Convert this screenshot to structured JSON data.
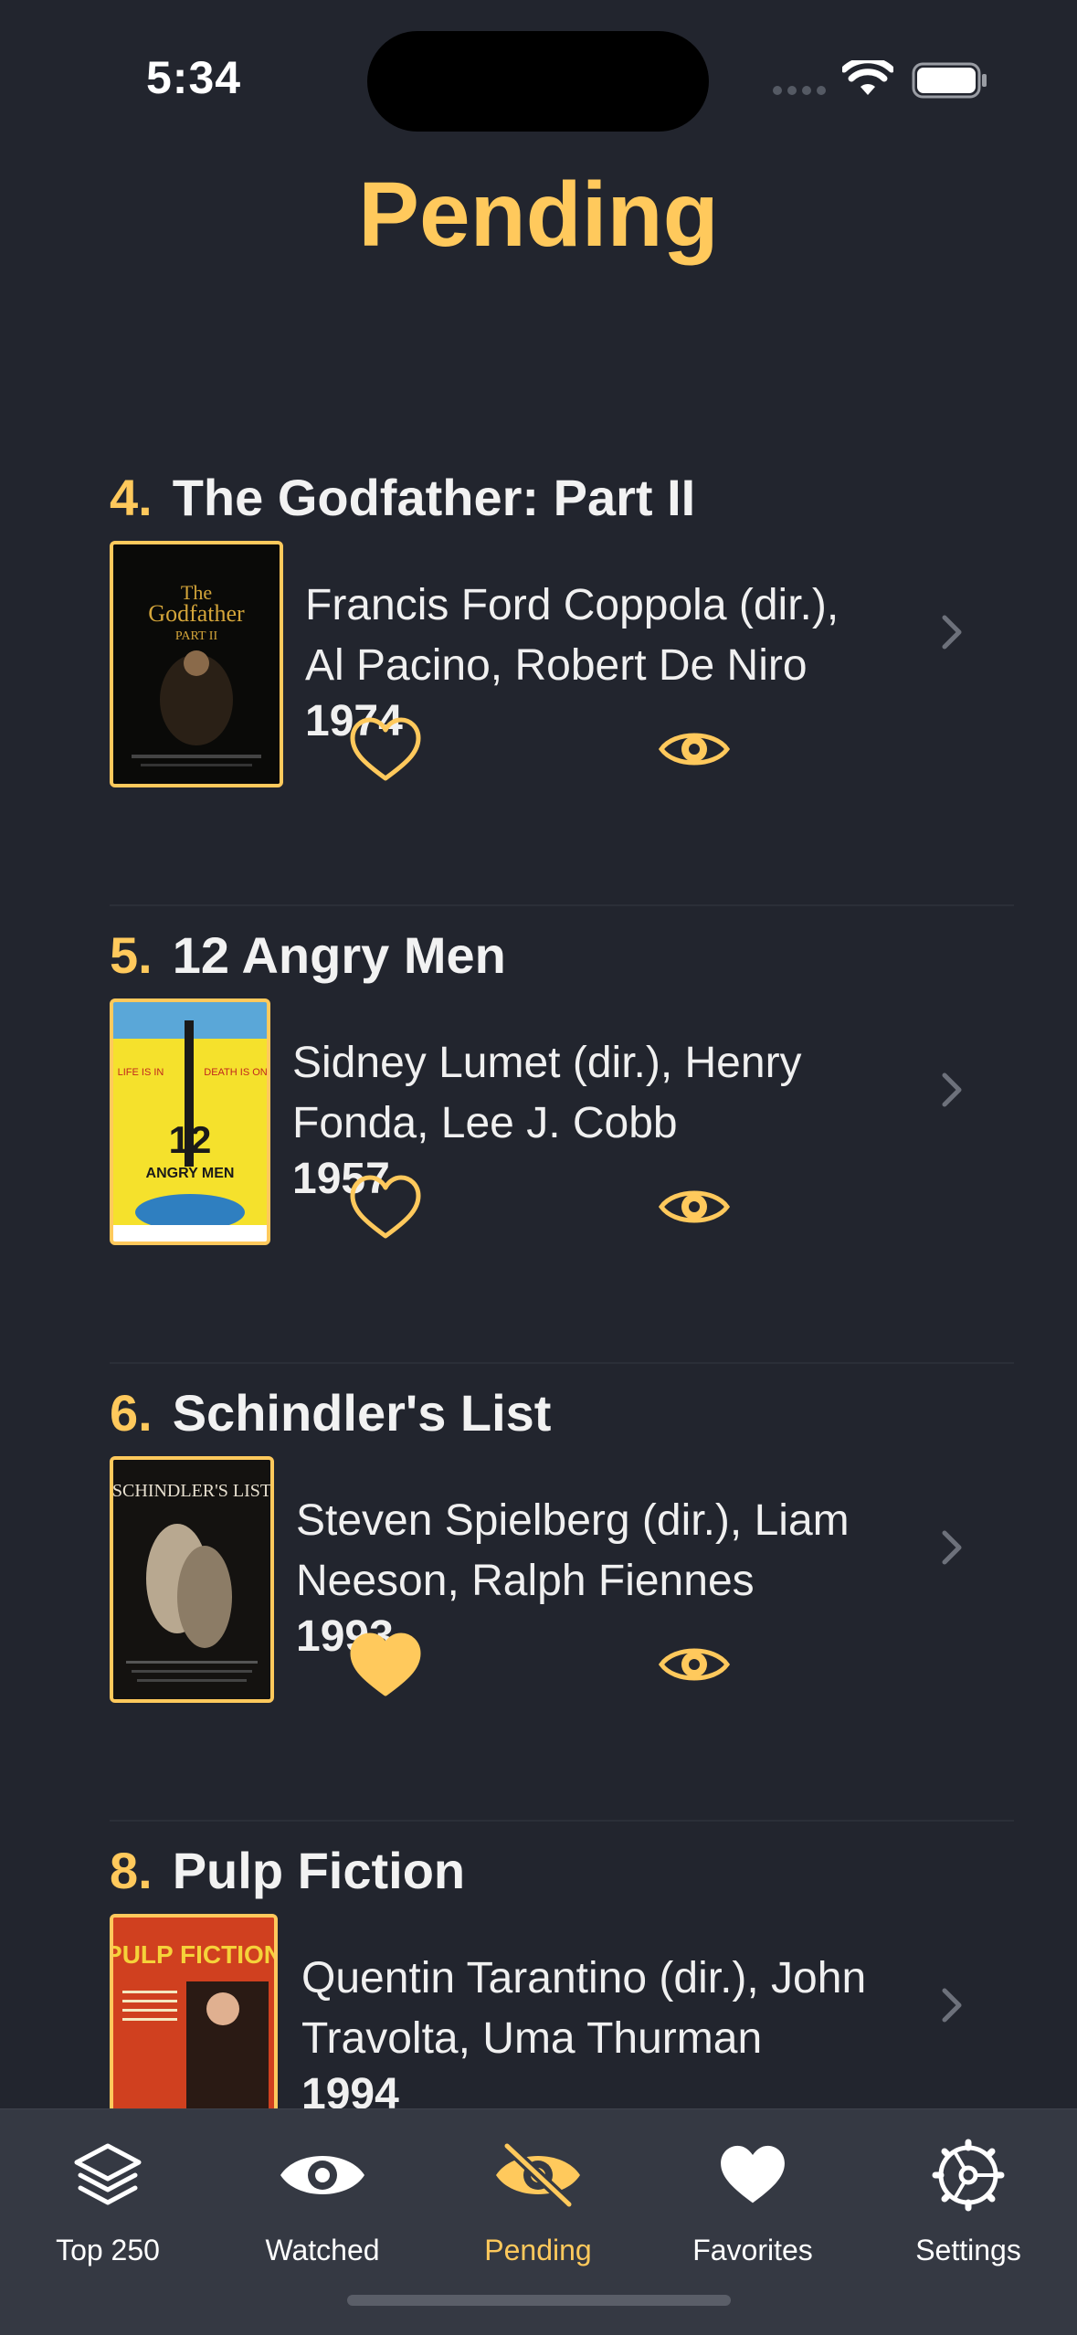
{
  "status": {
    "time": "5:34"
  },
  "page": {
    "title": "Pending"
  },
  "movies": [
    {
      "rank": "4.",
      "title": "The Godfather: Part II",
      "credits_line1": "Francis Ford Coppola (dir.),",
      "credits_line2": "Al Pacino, Robert De Niro",
      "year": "1974",
      "favorite": false,
      "poster_text": "The Godfather PART II"
    },
    {
      "rank": "5.",
      "title": "12 Angry Men",
      "credits_line1": "Sidney Lumet (dir.), Henry",
      "credits_line2": "Fonda, Lee J. Cobb",
      "year": "1957",
      "favorite": false,
      "poster_text": "12 ANGRY MEN"
    },
    {
      "rank": "6.",
      "title": "Schindler's List",
      "credits_line1": "Steven Spielberg (dir.), Liam",
      "credits_line2": "Neeson, Ralph Fiennes",
      "year": "1993",
      "favorite": true,
      "poster_text": "SCHINDLER'S LIST"
    },
    {
      "rank": "8.",
      "title": "Pulp Fiction",
      "credits_line1": "Quentin Tarantino (dir.), John",
      "credits_line2": "Travolta, Uma Thurman",
      "year": "1994",
      "favorite": false,
      "poster_text": "PULP FICTION"
    }
  ],
  "tabs": [
    {
      "label": "Top 250",
      "icon": "stack-icon",
      "active": false
    },
    {
      "label": "Watched",
      "icon": "eye-icon",
      "active": false
    },
    {
      "label": "Pending",
      "icon": "eye-slash-icon",
      "active": true
    },
    {
      "label": "Favorites",
      "icon": "heart-icon",
      "active": false
    },
    {
      "label": "Settings",
      "icon": "gear-icon",
      "active": false
    }
  ],
  "colors": {
    "background": "#22252e",
    "accent": "#ffc95c",
    "tab_bar": "#353943"
  }
}
